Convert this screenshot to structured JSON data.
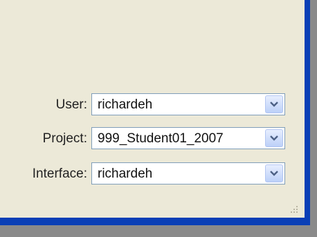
{
  "fields": [
    {
      "label": "User:",
      "value": "richardeh",
      "icon": "chevron-down-icon"
    },
    {
      "label": "Project:",
      "value": "999_Student01_2007",
      "icon": "chevron-down-icon"
    },
    {
      "label": "Interface:",
      "value": "richardeh",
      "icon": "chevron-down-icon"
    }
  ],
  "colors": {
    "panel": "#ece9d8",
    "frame": "#0a3fb6",
    "background": "#8a8a8a",
    "combo_border": "#7f9db9"
  },
  "icons": [
    "chevron-down-icon",
    "resize-grip-icon"
  ]
}
